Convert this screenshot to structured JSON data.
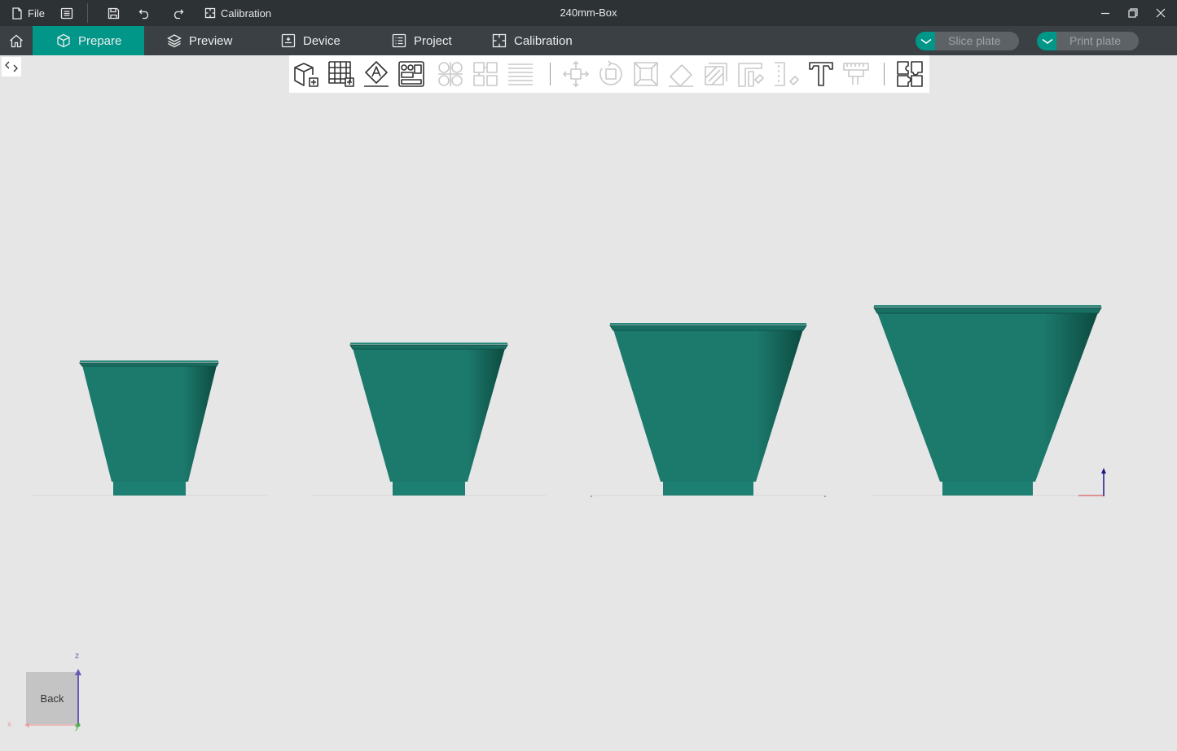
{
  "titlebar": {
    "file_label": "File",
    "calibration_label": "Calibration",
    "window_title": "240mm-Box",
    "icons": [
      "file-icon",
      "menu-icon",
      "save-icon",
      "undo-icon",
      "redo-icon",
      "calibration-icon",
      "minimize-icon",
      "restore-icon",
      "close-icon"
    ]
  },
  "nav": {
    "tabs": [
      {
        "label": "Prepare",
        "icon": "cube-icon",
        "active": true
      },
      {
        "label": "Preview",
        "icon": "layers-icon",
        "active": false
      },
      {
        "label": "Device",
        "icon": "device-icon",
        "active": false
      },
      {
        "label": "Project",
        "icon": "project-icon",
        "active": false
      },
      {
        "label": "Calibration",
        "icon": "calibration-icon",
        "active": false
      }
    ],
    "slice_label": "Slice plate",
    "print_label": "Print plate"
  },
  "toolbar": {
    "tools": [
      {
        "name": "add-object-icon",
        "enabled": true
      },
      {
        "name": "add-plate-icon",
        "enabled": true
      },
      {
        "name": "auto-orient-icon",
        "enabled": true
      },
      {
        "name": "arrange-icon",
        "enabled": true
      },
      {
        "name": "split-objects-icon",
        "enabled": false
      },
      {
        "name": "split-parts-icon",
        "enabled": false
      },
      {
        "name": "variable-layer-icon",
        "enabled": false
      },
      {
        "name": "move-icon",
        "enabled": false
      },
      {
        "name": "rotate-icon",
        "enabled": false
      },
      {
        "name": "scale-icon",
        "enabled": false
      },
      {
        "name": "lay-on-face-icon",
        "enabled": false
      },
      {
        "name": "cut-icon",
        "enabled": false
      },
      {
        "name": "support-paint-icon",
        "enabled": false
      },
      {
        "name": "seam-paint-icon",
        "enabled": false
      },
      {
        "name": "text-icon",
        "enabled": true
      },
      {
        "name": "measure-icon",
        "enabled": false
      },
      {
        "name": "assembly-icon",
        "enabled": true
      }
    ]
  },
  "scene": {
    "model_color": "#1d7a6d",
    "objects": [
      "funnel-model-1",
      "funnel-model-2",
      "funnel-model-3",
      "funnel-model-4"
    ]
  },
  "viewcube": {
    "face_label": "Back",
    "axis_z": "z",
    "axis_x": "x",
    "axis_y": "y"
  },
  "colors": {
    "accent": "#009688",
    "titlebar_bg": "#2d3235",
    "navbar_bg": "#3a4044",
    "canvas_bg": "#e6e6e6"
  }
}
